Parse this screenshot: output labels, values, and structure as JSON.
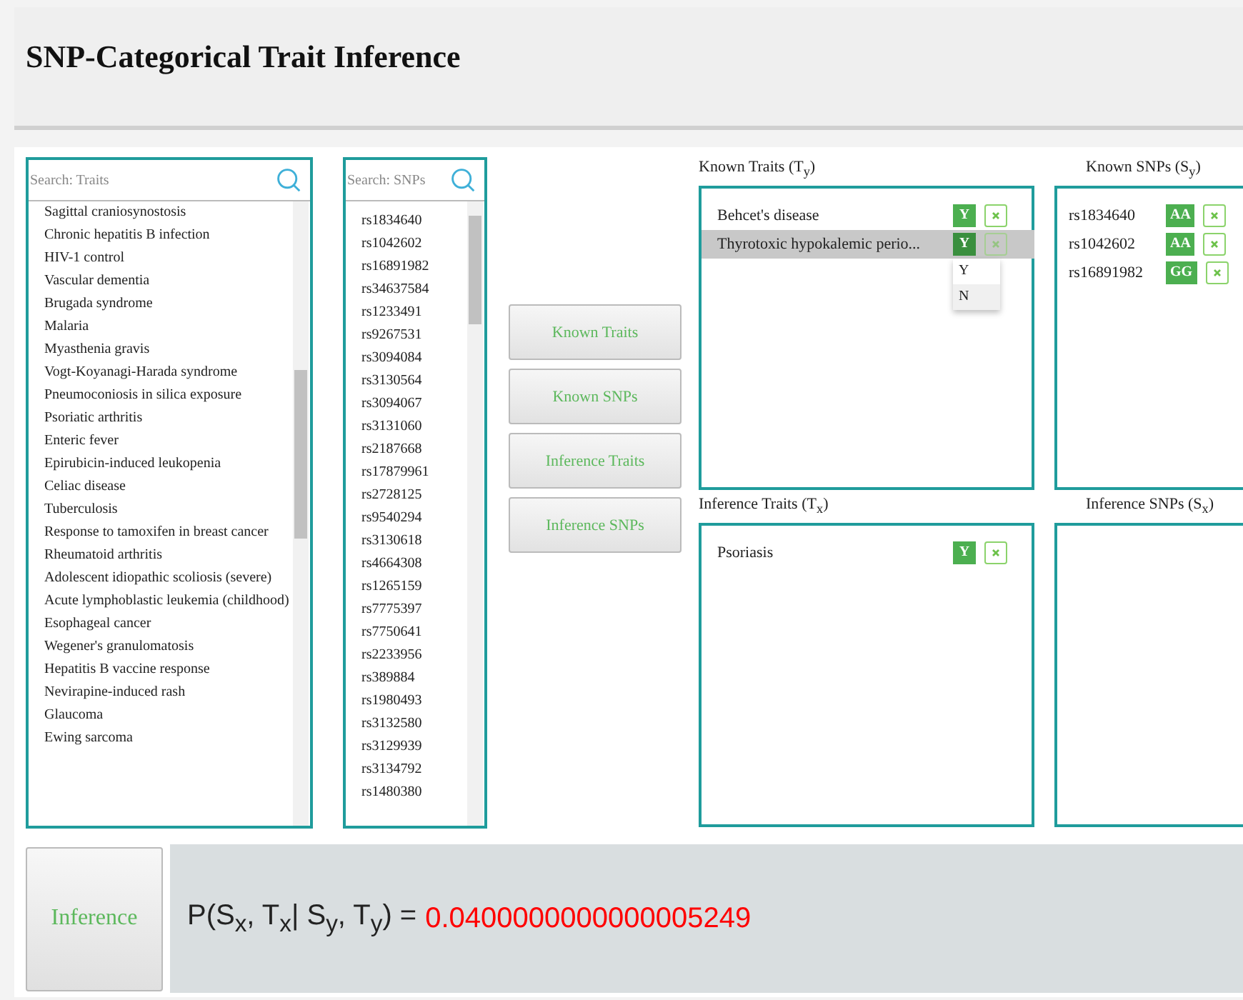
{
  "title": "SNP-Categorical Trait Inference",
  "trait_list": {
    "placeholder": "Search: Traits",
    "items": [
      "Sagittal craniosynostosis",
      "Chronic hepatitis B infection",
      "HIV-1 control",
      "Vascular dementia",
      "Brugada syndrome",
      "Malaria",
      "Myasthenia gravis",
      "Vogt-Koyanagi-Harada syndrome",
      "Pneumoconiosis in silica exposure",
      "Psoriatic arthritis",
      "Enteric fever",
      "Epirubicin-induced leukopenia",
      "Celiac disease",
      "Tuberculosis",
      "Response to tamoxifen in breast cancer",
      "Rheumatoid arthritis",
      "Adolescent idiopathic scoliosis (severe)",
      "Acute lymphoblastic leukemia (childhood)",
      "Esophageal cancer",
      "Wegener's granulomatosis",
      "Hepatitis B vaccine response",
      "Nevirapine-induced rash",
      "Glaucoma",
      "Ewing sarcoma"
    ]
  },
  "snp_list": {
    "placeholder": "Search: SNPs",
    "items": [
      "rs1834640",
      "rs1042602",
      "rs16891982",
      "rs34637584",
      "rs1233491",
      "rs9267531",
      "rs3094084",
      "rs3130564",
      "rs3094067",
      "rs3131060",
      "rs2187668",
      "rs17879961",
      "rs2728125",
      "rs9540294",
      "rs3130618",
      "rs4664308",
      "rs1265159",
      "rs7775397",
      "rs7750641",
      "rs2233956",
      "rs389884",
      "rs1980493",
      "rs3132580",
      "rs3129939",
      "rs3134792",
      "rs1480380"
    ]
  },
  "buttons": [
    "Known Traits",
    "Known SNPs",
    "Inference Traits",
    "Inference SNPs"
  ],
  "panels": [
    {
      "title": "Known Traits (T$_{y}$)",
      "rows": [
        {
          "name": "Behcet's disease",
          "value": "Y",
          "selected": false
        },
        {
          "name": "Thyrotoxic hypokalemic perio...",
          "value": "Y",
          "selected": true,
          "dropdown": [
            {
              "label": "Y",
              "highlighted": false
            },
            {
              "label": "N",
              "highlighted": true
            }
          ]
        }
      ]
    },
    {
      "title": "Known SNPs (S$_{y}$)",
      "rows": [
        {
          "name": "rs1834640",
          "value": "AA",
          "selected": false
        },
        {
          "name": "rs1042602",
          "value": "AA",
          "selected": false
        },
        {
          "name": "rs16891982",
          "value": "GG",
          "selected": false
        }
      ]
    },
    {
      "title": "Inference Traits (T$_{x}$)",
      "rows": [
        {
          "name": "Psoriasis",
          "value": "Y",
          "selected": false
        }
      ]
    },
    {
      "title": "Inference SNPs (S$_{x}$)"
    }
  ],
  "inference_button": "Inference",
  "result": {
    "formula": "P(S$_{x}$, T$_{x}$| S$_{y}$, T$_{y}$) = ",
    "value": "0.0400000000000005249"
  }
}
